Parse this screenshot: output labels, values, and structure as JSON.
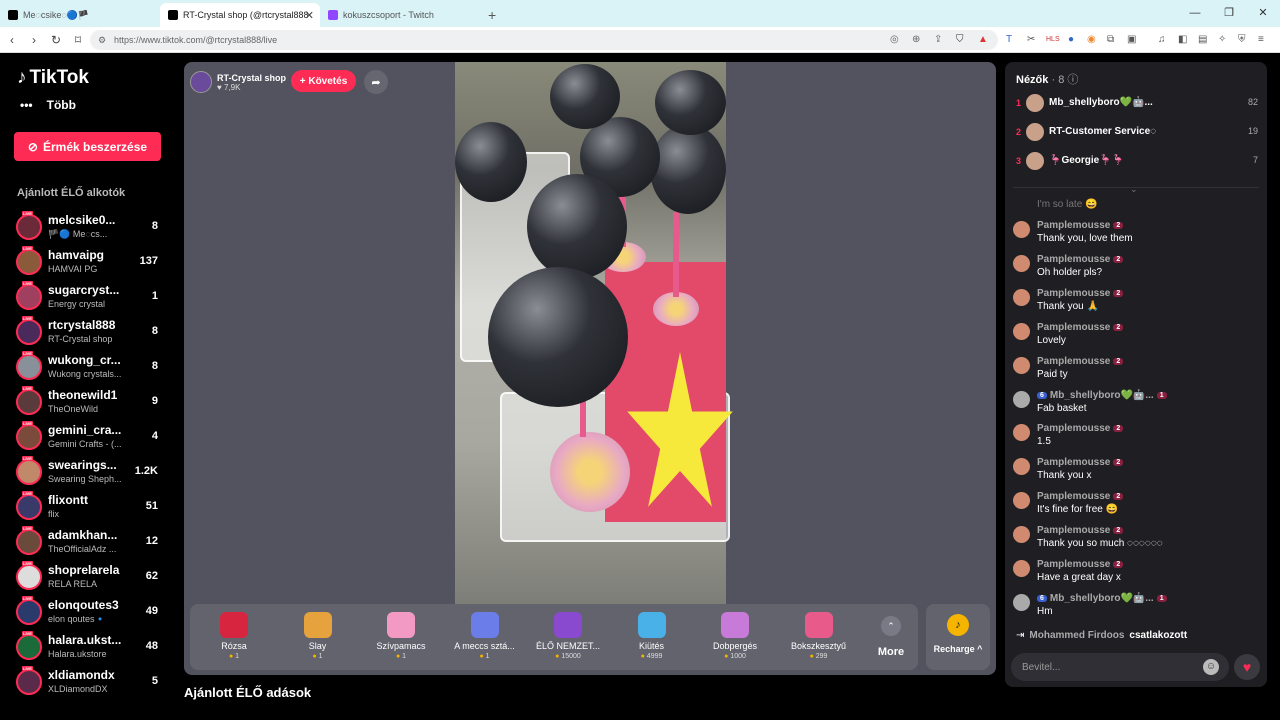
{
  "browser": {
    "tabs": [
      {
        "title": "Me◌csike◌🔵🏴",
        "active": false
      },
      {
        "title": "RT-Crystal shop (@rtcrystal888",
        "active": true
      },
      {
        "title": "kokuszcsoport - Twitch",
        "active": false
      }
    ],
    "new_tab": "+",
    "url": "https://www.tiktok.com/@rtcrystal888/live"
  },
  "sidebar": {
    "logo": "TikTok",
    "more": "Több",
    "buy_button": "Érmék beszerzése",
    "recommended_title": "Ajánlott ÉLŐ alkotók",
    "live_badge": "LIVE",
    "creators": [
      {
        "name": "melcsike0...",
        "sub": "🏴🔵 Me◌cs...",
        "count": "8"
      },
      {
        "name": "hamvaipg",
        "sub": "HAMVAI PG",
        "count": "137"
      },
      {
        "name": "sugarcryst...",
        "sub": "Energy crystal",
        "count": "1"
      },
      {
        "name": "rtcrystal888",
        "sub": "RT-Crystal shop",
        "count": "8"
      },
      {
        "name": "wukong_cr...",
        "sub": "Wukong crystals...",
        "count": "8"
      },
      {
        "name": "theonewild1",
        "sub": "TheOneWild",
        "count": "9"
      },
      {
        "name": "gemini_cra...",
        "sub": "Gemini Crafts - (...",
        "count": "4"
      },
      {
        "name": "swearings...",
        "sub": "Swearing Sheph...",
        "count": "1.2K"
      },
      {
        "name": "flixontt",
        "sub": "flix",
        "count": "51"
      },
      {
        "name": "adamkhan...",
        "sub": "TheOfficialAdz ...",
        "count": "12"
      },
      {
        "name": "shoprelarela",
        "sub": "RELA RELA",
        "count": "62"
      },
      {
        "name": "elonqoutes3",
        "sub": "elon qoutes🔹",
        "count": "49"
      },
      {
        "name": "halara.ukst...",
        "sub": "Halara.ukstore",
        "count": "48"
      },
      {
        "name": "xldiamondx",
        "sub": "XLDiamondDX",
        "count": "5"
      }
    ]
  },
  "player": {
    "streamer_name": "RT-Crystal shop",
    "likes": "♥ 7,9K",
    "follow": "+ Követés",
    "gifts": [
      {
        "name": "Rózsa",
        "price": "1"
      },
      {
        "name": "Slay",
        "price": "1"
      },
      {
        "name": "Szívpamacs",
        "price": "1"
      },
      {
        "name": "A meccs sztá...",
        "price": "1"
      },
      {
        "name": "ÉLŐ NEMZET...",
        "price": "15000"
      },
      {
        "name": "Kiütés",
        "price": "4999"
      },
      {
        "name": "Dobpergés",
        "price": "1000"
      },
      {
        "name": "Bokszkesztyű",
        "price": "299"
      }
    ],
    "more": "More",
    "recharge": "Recharge ^"
  },
  "recommended_live_title": "Ajánlott ÉLŐ adások",
  "chat": {
    "viewers_label": "Nézők",
    "viewers_count": "· 8",
    "top_viewers": [
      {
        "rank": "1",
        "name": "Mb_shellyboro💚🤖...",
        "score": "82"
      },
      {
        "rank": "2",
        "name": "RT-Customer Service◌",
        "score": "19"
      },
      {
        "rank": "3",
        "name": "🦩Georgie🦩🦩",
        "score": "7"
      }
    ],
    "faded_message": "I'm so late 😄",
    "messages": [
      {
        "user": "Pamplemousse",
        "badge": "2",
        "text": "Thank you, love them"
      },
      {
        "user": "Pamplemousse",
        "badge": "2",
        "text": "Oh holder pls?"
      },
      {
        "user": "Pamplemousse",
        "badge": "2",
        "text": "Thank you 🙏"
      },
      {
        "user": "Pamplemousse",
        "badge": "2",
        "text": "Lovely"
      },
      {
        "user": "Pamplemousse",
        "badge": "2",
        "text": "Paid ty"
      },
      {
        "user": "Mb_shellyboro💚🤖...",
        "badge": "1",
        "level": "6",
        "text": "Fab basket"
      },
      {
        "user": "Pamplemousse",
        "badge": "2",
        "text": "1.5"
      },
      {
        "user": "Pamplemousse",
        "badge": "2",
        "text": "Thank you x"
      },
      {
        "user": "Pamplemousse",
        "badge": "2",
        "text": "It's fine for free 😄"
      },
      {
        "user": "Pamplemousse",
        "badge": "2",
        "text": "Thank you so much ◌◌◌◌◌◌"
      },
      {
        "user": "Pamplemousse",
        "badge": "2",
        "text": "Have a great day x"
      },
      {
        "user": "Mb_shellyboro💚🤖...",
        "badge": "1",
        "level": "6",
        "text": "Hm"
      }
    ],
    "joined_user": "Mohammed Firdoos",
    "joined_action": "csatlakozott",
    "input_placeholder": "Bevitel..."
  }
}
